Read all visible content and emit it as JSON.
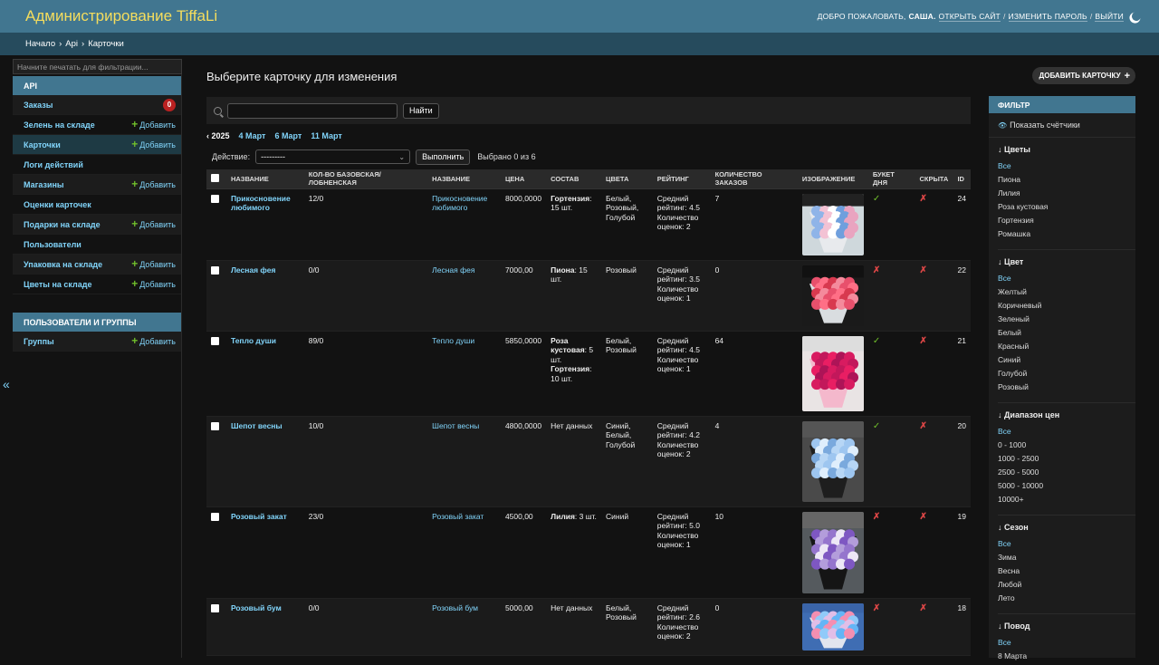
{
  "header": {
    "site_title": "Администрирование TiffaLi",
    "welcome": "ДОБРО ПОЖАЛОВАТЬ,",
    "username": "САША.",
    "view_site": "ОТКРЫТЬ САЙТ",
    "change_password": "ИЗМЕНИТЬ ПАРОЛЬ",
    "logout": "ВЫЙТИ",
    "sep": "/"
  },
  "breadcrumbs": {
    "home": "Начало",
    "app": "Api",
    "model": "Карточки",
    "sep": "›"
  },
  "sidebar": {
    "filter_placeholder": "Начните печатать для фильтрации...",
    "apps": [
      {
        "caption": "API",
        "models": [
          {
            "name": "Заказы",
            "badge": "0"
          },
          {
            "name": "Зелень на складе",
            "add": "Добавить"
          },
          {
            "name": "Карточки",
            "add": "Добавить",
            "current": true
          },
          {
            "name": "Логи действий"
          },
          {
            "name": "Магазины",
            "add": "Добавить"
          },
          {
            "name": "Оценки карточек"
          },
          {
            "name": "Подарки на складе",
            "add": "Добавить"
          },
          {
            "name": "Пользователи"
          },
          {
            "name": "Упаковка на складе",
            "add": "Добавить"
          },
          {
            "name": "Цветы на складе",
            "add": "Добавить"
          }
        ]
      },
      {
        "caption": "ПОЛЬЗОВАТЕЛИ И ГРУППЫ",
        "models": [
          {
            "name": "Группы",
            "add": "Добавить"
          }
        ]
      }
    ],
    "toggle": "«"
  },
  "main": {
    "title": "Выберите карточку для изменения",
    "add_button": "ДОБАВИТЬ КАРТОЧКУ",
    "add_icon": "+",
    "search_button": "Найти",
    "date_hierarchy": {
      "current": "‹ 2025",
      "links": [
        "4 Март",
        "6 Март",
        "11 Март"
      ]
    },
    "actions": {
      "label": "Действие:",
      "selected": "---------",
      "run": "Выполнить",
      "counter": "Выбрано 0 из 6"
    },
    "columns": [
      "Название",
      "Кол-во базовская/лобненская",
      "Название",
      "Цена",
      "Состав",
      "Цвета",
      "Рейтинг",
      "Количество заказов",
      "Изображение",
      "Букет дня",
      "Скрыта",
      "ID"
    ],
    "rows": [
      {
        "name": "Прикосновение любимого",
        "qty": "12/0",
        "name2": "Прикосновение любимого",
        "price": "8000,0000",
        "comp_bold": "Гортензия",
        "comp_rest": ": 15 шт.",
        "colors": "Белый, Розовый, Голубой",
        "rating": "Средний рейтинг: 4.5 Количество оценок: 2",
        "orders": "7",
        "img": "hydrangea",
        "bouquet": "yes",
        "hidden": "no",
        "id": "24"
      },
      {
        "name": "Лесная фея",
        "qty": "0/0",
        "name2": "Лесная фея",
        "price": "7000,00",
        "comp_bold": "Пиона",
        "comp_rest": ": 15 шт.",
        "colors": "Розовый",
        "rating": "Средний рейтинг: 3.5 Количество оценок: 1",
        "orders": "0",
        "img": "peony",
        "bouquet": "no",
        "hidden": "no",
        "id": "22"
      },
      {
        "name": "Тепло души",
        "qty": "89/0",
        "name2": "Тепло души",
        "price": "5850,0000",
        "comp_bold": "Роза кустовая",
        "comp_rest": ": 5 шт.",
        "comp_bold2": "Гортензия",
        "comp_rest2": ": 10 шт.",
        "colors": "Белый, Розовый",
        "rating": "Средний рейтинг: 4.5 Количество оценок: 1",
        "orders": "64",
        "img": "roses",
        "bouquet": "yes",
        "hidden": "no",
        "id": "21"
      },
      {
        "name": "Шепот весны",
        "qty": "10/0",
        "name2": "Шепот весны",
        "price": "4800,0000",
        "comp_plain": "Нет данных",
        "colors": "Синий, Белый, Голубой",
        "rating": "Средний рейтинг: 4.2 Количество оценок: 2",
        "orders": "4",
        "img": "blue",
        "bouquet": "yes",
        "hidden": "no",
        "id": "20"
      },
      {
        "name": "Розовый закат",
        "qty": "23/0",
        "name2": "Розовый закат",
        "price": "4500,00",
        "comp_bold": "Лилия",
        "comp_rest": ": 3 шт.",
        "colors": "Синий",
        "rating": "Средний рейтинг: 5.0 Количество оценок: 1",
        "orders": "10",
        "img": "purple",
        "bouquet": "no",
        "hidden": "no",
        "id": "19"
      },
      {
        "name": "Розовый бум",
        "qty": "0/0",
        "name2": "Розовый бум",
        "price": "5000,00",
        "comp_plain": "Нет данных",
        "colors": "Белый, Розовый",
        "rating": "Средний рейтинг: 2.6 Количество оценок: 2",
        "orders": "0",
        "img": "pinkblue",
        "bouquet": "no",
        "hidden": "no",
        "id": "18"
      }
    ]
  },
  "filter": {
    "title": "ФИЛЬТР",
    "show_counts": "Показать счётчики",
    "groups": [
      {
        "title": "↓ Цветы",
        "items": [
          "Все",
          "Пиона",
          "Лилия",
          "Роза кустовая",
          "Гортензия",
          "Ромашка"
        ]
      },
      {
        "title": "↓ Цвет",
        "items": [
          "Все",
          "Желтый",
          "Коричневый",
          "Зеленый",
          "Белый",
          "Красный",
          "Синий",
          "Голубой",
          "Розовый"
        ]
      },
      {
        "title": "↓ Диапазон цен",
        "items": [
          "Все",
          "0 - 1000",
          "1000 - 2500",
          "2500 - 5000",
          "5000 - 10000",
          "10000+"
        ]
      },
      {
        "title": "↓ Сезон",
        "items": [
          "Все",
          "Зима",
          "Весна",
          "Любой",
          "Лето"
        ]
      },
      {
        "title": "↓ Повод",
        "items": [
          "Все",
          "8 Марта"
        ]
      }
    ]
  },
  "colors": {
    "header": "#417690",
    "breadcrumbs": "#264b5d",
    "title": "#f5dd5d",
    "link": "#81d4fa",
    "yes": "#70bf2b",
    "no": "#dd4646"
  },
  "icons": {
    "yes": "✓",
    "no": "✗",
    "theme": "moon-icon",
    "search": "search-icon"
  }
}
